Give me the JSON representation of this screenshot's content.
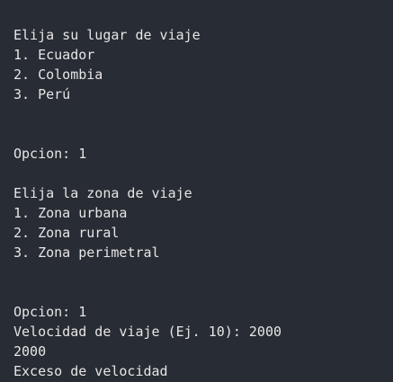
{
  "output": {
    "lines": [
      "Elija su lugar de viaje",
      "1. Ecuador",
      "2. Colombia",
      "3. Perú",
      "",
      "",
      "Opcion: 1",
      "",
      "Elija la zona de viaje",
      "1. Zona urbana",
      "2. Zona rural",
      "3. Zona perimetral",
      "",
      "",
      "Opcion: 1",
      "Velocidad de viaje (Ej. 10): 2000",
      "2000",
      "Exceso de velocidad"
    ]
  },
  "colors": {
    "background": "#282c34",
    "text": "#e6e6e6",
    "prompt_accent": "#e5a55f"
  }
}
